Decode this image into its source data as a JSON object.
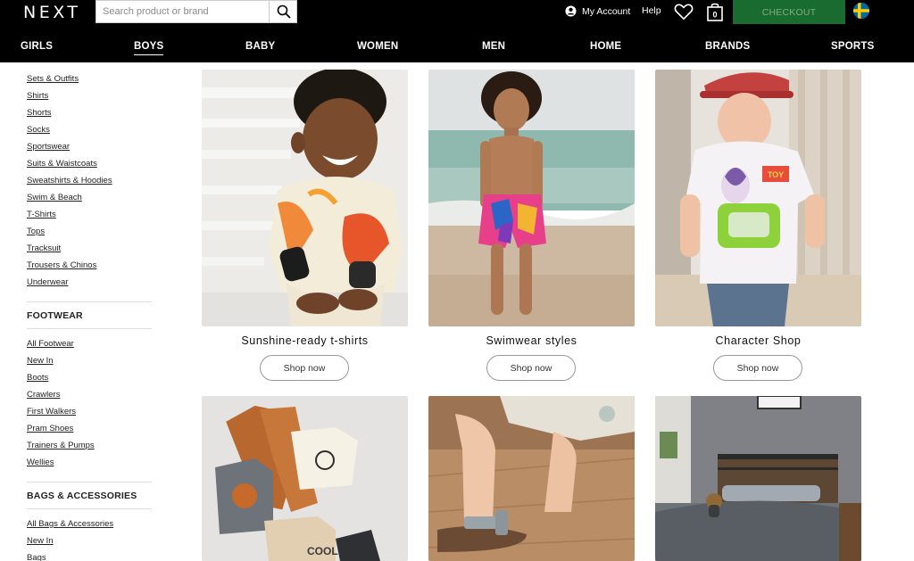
{
  "header": {
    "logo": "NEXT",
    "search_placeholder": "Search product or brand",
    "my_account": "My Account",
    "help": "Help",
    "bag_count": "0",
    "checkout": "CHECKOUT"
  },
  "nav": {
    "items": [
      {
        "label": "GIRLS"
      },
      {
        "label": "BOYS",
        "active": true
      },
      {
        "label": "BABY"
      },
      {
        "label": "WOMEN"
      },
      {
        "label": "MEN"
      },
      {
        "label": "HOME"
      },
      {
        "label": "BRANDS"
      },
      {
        "label": "SPORTS"
      }
    ]
  },
  "sidebar": {
    "clothing_links": [
      "Sets & Outfits",
      "Shirts",
      "Shorts",
      "Socks",
      "Sportswear",
      "Suits & Waistcoats",
      "Sweatshirts & Hoodies",
      "Swim & Beach",
      "T-Shirts",
      "Tops",
      "Tracksuit",
      "Trousers & Chinos",
      "Underwear"
    ],
    "footwear_heading": "FOOTWEAR",
    "footwear_links": [
      "All Footwear",
      "New In",
      "Boots",
      "Crawlers",
      "First Walkers",
      "Pram Shoes",
      "Trainers & Pumps",
      "Wellies"
    ],
    "bags_heading": "BAGS & ACCESSORIES",
    "bags_links": [
      "All Bags & Accessories",
      "New In",
      "Bags"
    ]
  },
  "tiles": [
    {
      "title": "Sunshine-ready t-shirts",
      "button": "Shop now"
    },
    {
      "title": "Swimwear styles",
      "button": "Shop now"
    },
    {
      "title": "Character Shop",
      "button": "Shop now"
    }
  ],
  "tile_images_row2": [
    "Printed tees and shorts flat-lay",
    "Child wearing sandals",
    "Kids bedroom with bed"
  ],
  "colors": {
    "header_bg": "#000000",
    "checkout_bg": "#1a6b2f",
    "checkout_text": "#7fae84",
    "text": "#222222"
  }
}
